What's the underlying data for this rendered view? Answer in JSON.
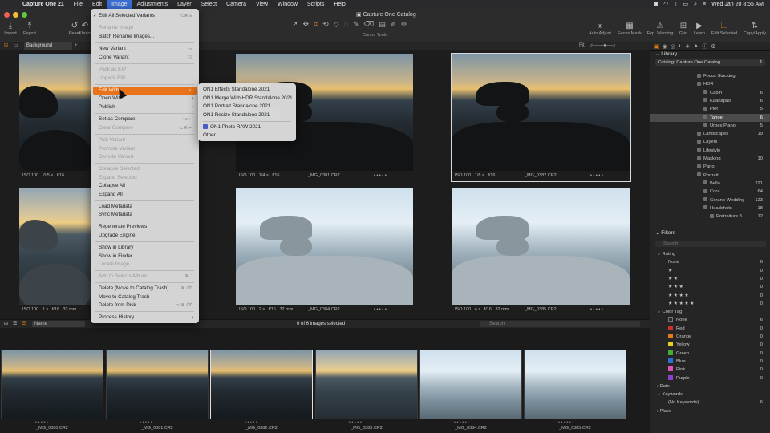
{
  "menubar": {
    "app": "Capture One 21",
    "items": [
      "File",
      "Edit",
      "Image",
      "Adjustments",
      "Layer",
      "Select",
      "Camera",
      "View",
      "Window",
      "Scripts",
      "Help"
    ],
    "clock": "Wed Jan 20  8:55 AM"
  },
  "window": {
    "title": "Capture One Catalog"
  },
  "toolbar": {
    "left": [
      "Import",
      "Export",
      "Reset",
      "Undo"
    ],
    "cursor_label": "Cursor Tools",
    "right": [
      "Auto Adjust",
      "Focus Mask",
      "Exp. Warning",
      "Grid",
      "Learn",
      "Edit Selected",
      "Copy/Apply"
    ]
  },
  "viewer": {
    "background_select": "Background",
    "fit_label": "Fit",
    "images": [
      {
        "name": "_MG_0380.CR2",
        "iso": "ISO 100",
        "shutter": "",
        "aperture": "",
        "focal": ""
      },
      {
        "name": "_MG_0381.CR2",
        "iso": "ISO 100",
        "shutter": "1/4 s",
        "aperture": "f/16",
        "focal": ""
      },
      {
        "name": "_MG_0382.CR2",
        "iso": "ISO 100",
        "shutter": "1/8 s",
        "aperture": "f/16",
        "focal": ""
      },
      {
        "name": "_MG_0383.CR2",
        "iso": "ISO 100",
        "shutter": "1 s",
        "aperture": "f/16",
        "focal": "32 mm"
      },
      {
        "name": "_MG_0384.CR2",
        "iso": "ISO 100",
        "shutter": "2 s",
        "aperture": "f/16",
        "focal": "32 mm"
      },
      {
        "name": "_MG_0385.CR2",
        "iso": "ISO 100",
        "shutter": "4 s",
        "aperture": "f/16",
        "focal": "32 mm"
      }
    ],
    "first_meta": {
      "iso": "ISO 100",
      "shutter": "0.5 s",
      "aperture": "f/16"
    },
    "rating_dots": "• • • • •"
  },
  "filmstrip": {
    "sort": "Name",
    "count_text": "6 of 6 images selected",
    "search_placeholder": "Search",
    "names": [
      "_MG_0380.CR2",
      "_MG_0381.CR2",
      "_MG_0382.CR2",
      "_MG_0383.CR2",
      "_MG_0384.CR2",
      "_MG_0385.CR2"
    ]
  },
  "image_menu": {
    "items": [
      {
        "label": "Edit All Selected Variants",
        "shortcut": "⌥⌘ E",
        "checked": true
      },
      {
        "label": "Rename Image",
        "disabled": true
      },
      {
        "label": "Batch Rename Images..."
      },
      {
        "label": "New Variant",
        "shortcut": "F2"
      },
      {
        "label": "Clone Variant",
        "shortcut": "F3"
      },
      {
        "label": "Pack as EIP",
        "disabled": true
      },
      {
        "label": "Unpack EIP",
        "disabled": true
      },
      {
        "label": "Edit With",
        "submenu": true,
        "highlighted": true
      },
      {
        "label": "Open With",
        "submenu": true
      },
      {
        "label": "Publish",
        "submenu": true
      },
      {
        "label": "Set as Compare",
        "shortcut": "⌥ ↩"
      },
      {
        "label": "Clear Compare",
        "shortcut": "⌥⌘ ↩",
        "disabled": true
      },
      {
        "label": "Pick Variant",
        "disabled": true
      },
      {
        "label": "Promote Variant",
        "disabled": true
      },
      {
        "label": "Demote Variant",
        "disabled": true
      },
      {
        "label": "Collapse Selected",
        "disabled": true
      },
      {
        "label": "Expand Selected",
        "disabled": true
      },
      {
        "label": "Collapse All"
      },
      {
        "label": "Expand All"
      },
      {
        "label": "Load Metadata"
      },
      {
        "label": "Sync Metadata"
      },
      {
        "label": "Regenerate Previews"
      },
      {
        "label": "Upgrade Engine"
      },
      {
        "label": "Show in Library"
      },
      {
        "label": "Show in Finder"
      },
      {
        "label": "Locate Image...",
        "disabled": true
      },
      {
        "label": "Add to Selects Album",
        "shortcut": "⌘ J",
        "disabled": true
      },
      {
        "label": "Delete (Move to Catalog Trash)",
        "shortcut": "⌘ ⌫"
      },
      {
        "label": "Move to Catalog Trash"
      },
      {
        "label": "Delete from Disk...",
        "shortcut": "⌥⌘ ⌫"
      },
      {
        "label": "Process History",
        "submenu": true
      }
    ],
    "submenu_edit_with": [
      "ON1 Effects Standalone 2021",
      "ON1 Merge With HDR Standalone 2021",
      "ON1 Portrait Standalone 2021",
      "ON1 Resize Standalone 2021",
      "ON1 Photo RAW 2021",
      "Other..."
    ]
  },
  "library": {
    "header": "Library",
    "catalog_select": "Catalog: Capture One Catalog",
    "tree": [
      {
        "label": "Focus Stacking",
        "count": ""
      },
      {
        "label": "HDR",
        "count": ""
      },
      {
        "label": "Cabin",
        "count": "6"
      },
      {
        "label": "Kaanapali",
        "count": "6"
      },
      {
        "label": "Pier",
        "count": "5"
      },
      {
        "label": "Tahoe",
        "count": "6",
        "selected": true
      },
      {
        "label": "Urbex Piano",
        "count": "5"
      },
      {
        "label": "Landscapes",
        "count": "19"
      },
      {
        "label": "Layers",
        "count": ""
      },
      {
        "label": "Lifestyle",
        "count": ""
      },
      {
        "label": "Masking",
        "count": "10"
      },
      {
        "label": "Pano",
        "count": ""
      },
      {
        "label": "Portrait",
        "count": ""
      },
      {
        "label": "Bella",
        "count": "221"
      },
      {
        "label": "Cora",
        "count": "64"
      },
      {
        "label": "Corano Wedding",
        "count": "123"
      },
      {
        "label": "Headshots",
        "count": "18"
      },
      {
        "label": "Portraiture 3...",
        "count": "12"
      }
    ]
  },
  "filters": {
    "header": "Filters",
    "search_placeholder": "Search",
    "rating_header": "Rating",
    "ratings": [
      {
        "label": "None",
        "count": "6"
      },
      {
        "label": "★",
        "count": "0"
      },
      {
        "label": "★ ★",
        "count": "0"
      },
      {
        "label": "★ ★ ★",
        "count": "0"
      },
      {
        "label": "★ ★ ★ ★",
        "count": "0"
      },
      {
        "label": "★ ★ ★ ★ ★",
        "count": "0"
      }
    ],
    "color_tag_header": "Color Tag",
    "color_tags": [
      {
        "label": "None",
        "count": "6",
        "color": "#2a2a2a"
      },
      {
        "label": "Red",
        "count": "0",
        "color": "#d0302a"
      },
      {
        "label": "Orange",
        "count": "0",
        "color": "#e67a1e"
      },
      {
        "label": "Yellow",
        "count": "0",
        "color": "#e3cf2a"
      },
      {
        "label": "Green",
        "count": "0",
        "color": "#3fae3a"
      },
      {
        "label": "Blue",
        "count": "0",
        "color": "#2f6fd6"
      },
      {
        "label": "Pink",
        "count": "0",
        "color": "#e04fb3"
      },
      {
        "label": "Purple",
        "count": "0",
        "color": "#8d3fd0"
      }
    ],
    "date_header": "Date",
    "keywords_header": "Keywords",
    "no_keywords": "(No Keywords)",
    "no_keywords_count": "6",
    "place_header": "Place"
  },
  "colors": {
    "accent": "#e8731a",
    "selection_blue": "#3b6fd6"
  }
}
